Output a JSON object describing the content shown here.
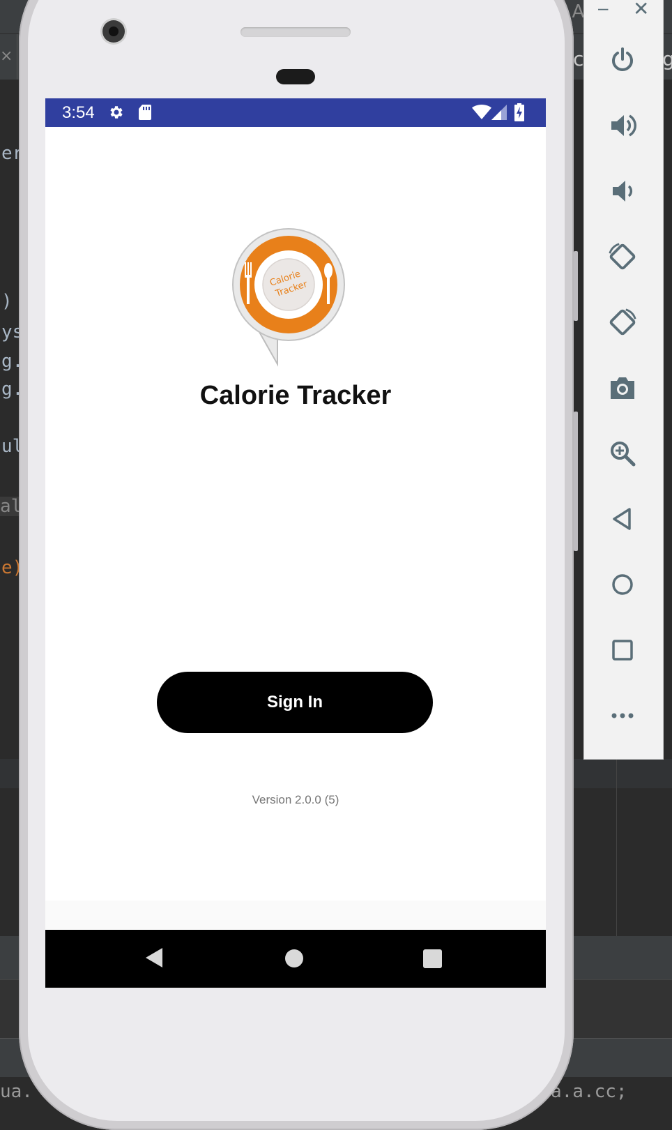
{
  "ide": {
    "title_fragment": "XL A",
    "tab_fragment_1": "co",
    "tab_fragment_2": "g",
    "tab_close": "×",
    "code_fragments": [
      {
        "text": "er",
        "style": "normal"
      },
      {
        "text": ")",
        "style": "normal"
      },
      {
        "text": "ys",
        "style": "normal"
      },
      {
        "text": "g.",
        "style": "normal"
      },
      {
        "text": "g.",
        "style": "normal"
      },
      {
        "text": "ul",
        "style": "normal"
      },
      {
        "text": "aln",
        "style": "hl"
      },
      {
        "text": "e)",
        "style": "orange"
      }
    ],
    "status_fragment_left": "ua.",
    "status_fragment_right": "a.a.cc;"
  },
  "phone": {
    "status_bar": {
      "time": "3:54",
      "icons": [
        "gear-icon",
        "sd-card-icon",
        "wifi-icon",
        "signal-icon",
        "battery-icon"
      ],
      "color": "#303f9f"
    },
    "app": {
      "logo_text_line1": "Calorie",
      "logo_text_line2": "Tracker",
      "title": "Calorie Tracker",
      "signin_label": "Sign In",
      "version": "Version 2.0.0 (5)",
      "accent_color": "#e8801a"
    },
    "nav_bar": {
      "icons": [
        "back-icon",
        "home-icon",
        "recents-icon"
      ]
    }
  },
  "emulator_toolbar": {
    "window_controls": [
      "minimize-icon",
      "close-icon"
    ],
    "minimize_glyph": "–",
    "close_glyph": "✕",
    "buttons": [
      "power-icon",
      "volume-up-icon",
      "volume-down-icon",
      "rotate-left-icon",
      "rotate-right-icon",
      "camera-icon",
      "zoom-icon",
      "back-icon",
      "home-icon",
      "overview-icon",
      "more-icon"
    ]
  }
}
